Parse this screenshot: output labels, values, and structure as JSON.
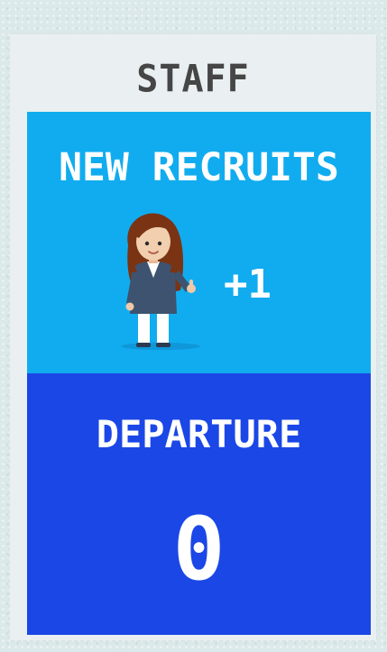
{
  "staff_card": {
    "title": "STAFF",
    "new_recruits": {
      "label": "NEW RECRUITS",
      "count": "+1",
      "illustration": "woman-thumbs-up-icon",
      "color": "#11acef"
    },
    "departure": {
      "label": "DEPARTURE",
      "count": "0",
      "color": "#1b47e6"
    }
  }
}
